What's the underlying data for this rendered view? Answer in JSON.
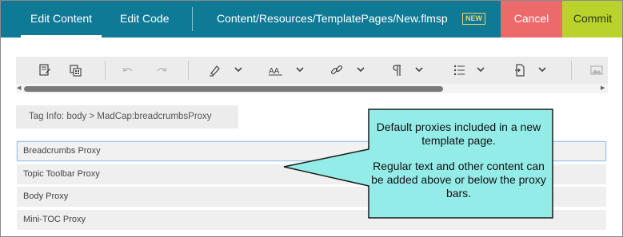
{
  "topbar": {
    "tab_edit_content": "Edit Content",
    "tab_edit_code": "Edit Code",
    "file_path": "Content/Resources/TemplatePages/New.flmsp",
    "new_badge": "NEW",
    "cancel_label": "Cancel",
    "commit_label": "Commit",
    "colors": {
      "bar": "#0f7a96",
      "cancel": "#ec6a6a",
      "commit": "#b9d22c",
      "badge": "#e9d36b"
    }
  },
  "toolbar": {
    "icons": [
      "insert-snippet-icon",
      "insert-variable-icon",
      "undo-icon",
      "redo-icon",
      "highlight-icon",
      "font-format-icon",
      "link-icon",
      "paragraph-icon",
      "list-icon",
      "insert-file-icon",
      "image-icon"
    ]
  },
  "tag_info": {
    "label": "Tag Info:",
    "tag": "body",
    "separator": ">",
    "child": "MadCap:breadcrumbsProxy"
  },
  "proxies": [
    {
      "label": "Breadcrumbs Proxy",
      "selected": true
    },
    {
      "label": "Topic Toolbar Proxy",
      "selected": false
    },
    {
      "label": "Body Proxy",
      "selected": false
    },
    {
      "label": "Mini-TOC Proxy",
      "selected": false
    }
  ],
  "callout": {
    "line1": "Default proxies included in a new template page.",
    "line2": "Regular text and other content can be added above or below the proxy bars.",
    "fill": "#93ece8"
  }
}
